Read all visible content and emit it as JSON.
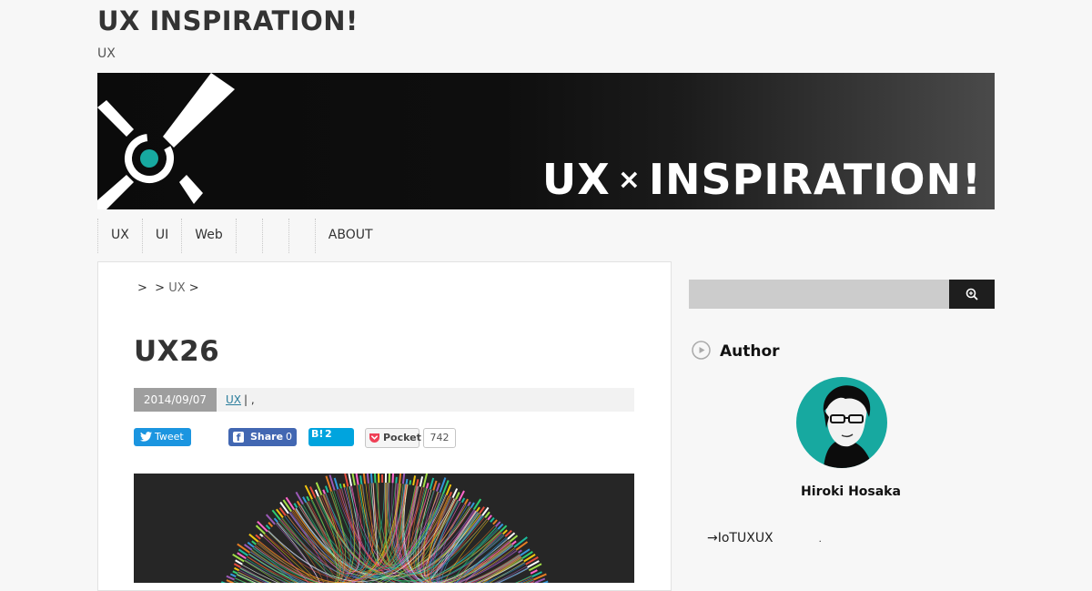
{
  "site": {
    "title": "UX INSPIRATION!",
    "description": "UX"
  },
  "banner": {
    "text_left": "UX",
    "text_x": "×",
    "text_right": "INSPIRATION!",
    "accent_color": "#17a9a0"
  },
  "nav": {
    "items": [
      "UX",
      "UI",
      "Web",
      "",
      "",
      "",
      "ABOUT"
    ]
  },
  "breadcrumb": {
    "sep1": ">",
    "sep2": ">",
    "category": "UX",
    "sep3": ">"
  },
  "post": {
    "title": "UX26",
    "date": "2014/09/07",
    "category": "UX",
    "meta_sep": "| ,"
  },
  "share": {
    "tweet_label": "Tweet",
    "facebook_label": "Share",
    "facebook_count": "0",
    "hatena_mark": "B!",
    "hatena_count": "2",
    "pocket_label": "Pocket",
    "pocket_count": "742"
  },
  "sidebar": {
    "search": {
      "placeholder": "",
      "icon": "search-icon"
    },
    "author": {
      "heading": "Author",
      "name": "Hiroki Hosaka",
      "bio": "→IoTUXUX",
      "bio_dot": "."
    }
  },
  "colors": {
    "tweet": "#1b95e0",
    "facebook": "#4267b2",
    "hatena": "#00a4de",
    "avatar_bg": "#17a9a0",
    "link": "#2a7d9c"
  }
}
